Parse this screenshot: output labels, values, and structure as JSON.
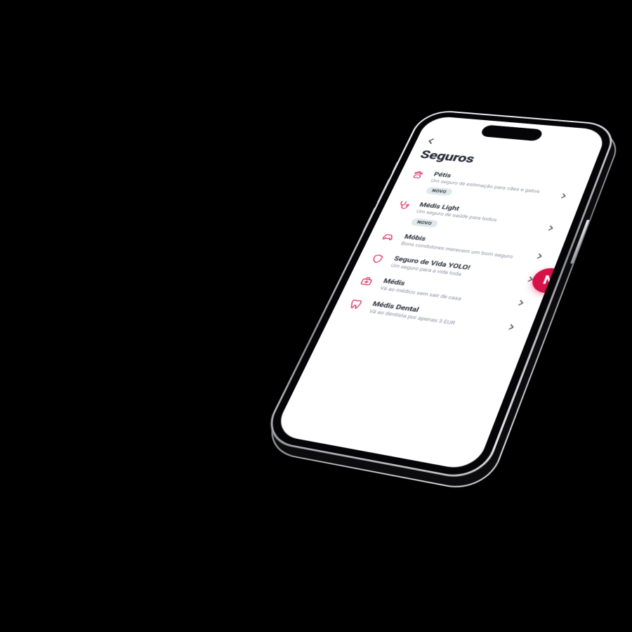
{
  "colors": {
    "accent": "#d7114a",
    "ink": "#2a2f3b",
    "muted": "#8b90a0",
    "badge_bg": "#dfe8ea"
  },
  "header": {
    "title": "Seguros"
  },
  "floating_button": {
    "label": "N"
  },
  "items": [
    {
      "icon": "paw-icon",
      "title": "Pétis",
      "desc": "Um seguro de estimação para cães e gatos",
      "badge": "NOVO"
    },
    {
      "icon": "stethoscope-icon",
      "title": "Médis Light",
      "desc": "Um seguro de saúde para todos",
      "badge": "NOVO"
    },
    {
      "icon": "car-icon",
      "title": "Móbis",
      "desc": "Bons condutores merecem um bom seguro",
      "badge": null
    },
    {
      "icon": "shield-icon",
      "title": "Seguro de Vida YOLO!",
      "desc": "Um seguro para a vida toda",
      "badge": null
    },
    {
      "icon": "medkit-icon",
      "title": "Médis",
      "desc": "Vá ao médico sem sair de casa",
      "badge": null
    },
    {
      "icon": "tooth-icon",
      "title": "Médis Dental",
      "desc": "Vá ao dentista por apenas 3 EUR",
      "badge": null
    }
  ]
}
